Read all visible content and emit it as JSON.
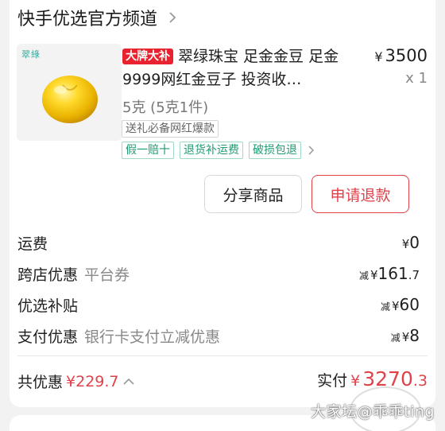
{
  "shop": {
    "name": "快手优选官方频道"
  },
  "product": {
    "brand_mark": "翠綠",
    "promo_badge": "大牌大补",
    "title": "翠绿珠宝 足金金豆 足金9999网红金豆子 投资收…",
    "price_symbol": "¥",
    "price": "3500",
    "quantity": "x 1",
    "spec": "5克 (5克1件)",
    "tag": "送礼必备网红爆款",
    "service_tags": [
      "假一赔十",
      "退货补运费",
      "破损包退"
    ]
  },
  "actions": {
    "share_label": "分享商品",
    "refund_label": "申请退款"
  },
  "fees": {
    "shipping": {
      "label": "运费",
      "yen": "¥",
      "value": "0"
    },
    "cross_store": {
      "label": "跨店优惠",
      "sub": "平台券",
      "prefix": "减",
      "yen": "¥",
      "value": "161",
      "decimal": ".7"
    },
    "subsidy": {
      "label": "优选补贴",
      "prefix": "减",
      "yen": "¥",
      "value": "60"
    },
    "payment": {
      "label": "支付优惠",
      "sub": "银行卡支付立减优惠",
      "prefix": "减",
      "yen": "¥",
      "value": "8"
    }
  },
  "summary": {
    "discount_label": "共优惠",
    "discount_value": "¥229.7",
    "paid_label": "实付",
    "paid_yen": "¥",
    "paid_int": "3270",
    "paid_dec": ".3"
  },
  "watermark": "大家坛@乖乖ting",
  "colors": {
    "accent": "#e0424a",
    "service_tag": "#1f9b72",
    "gold": "#f5c400"
  },
  "icons": {
    "shop_chevron": "chevron-right-icon",
    "tags_chevron": "chevron-right-icon",
    "discount_toggle": "chevron-up-icon"
  }
}
